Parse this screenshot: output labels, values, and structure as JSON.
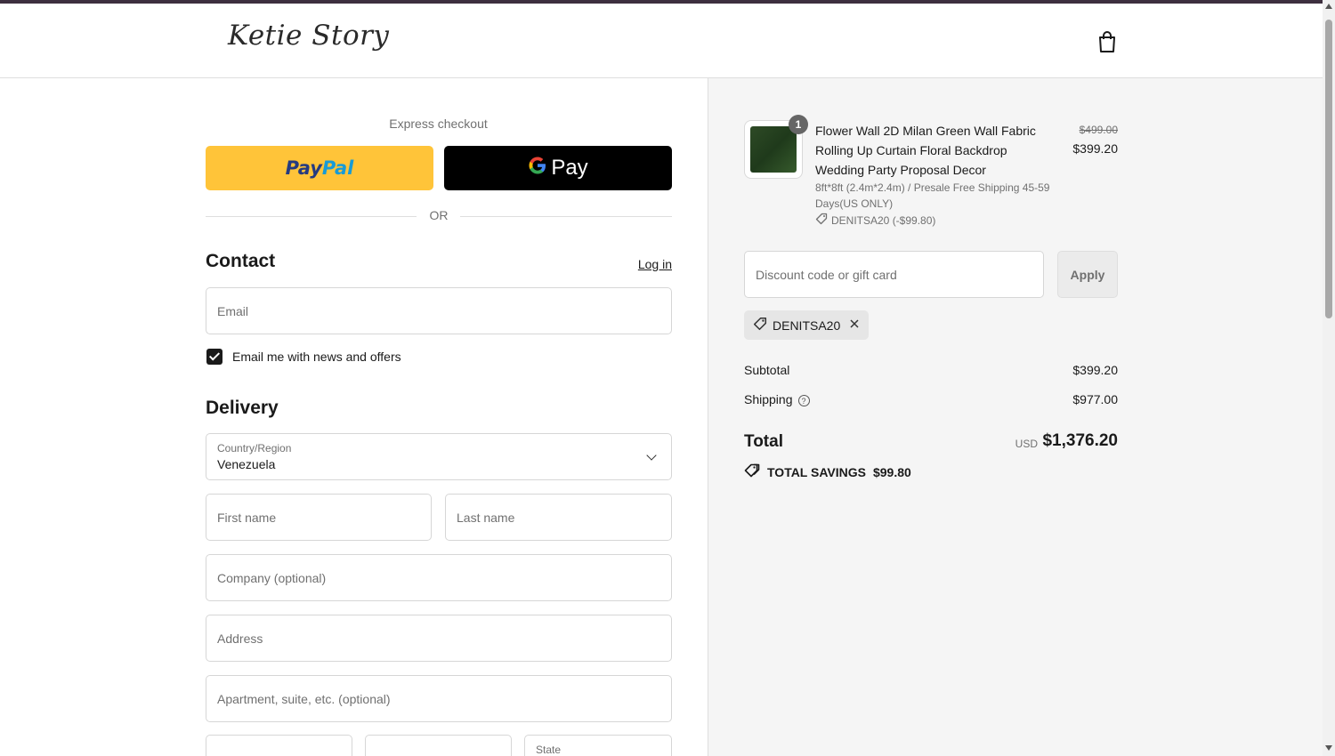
{
  "header": {
    "logo_text": "Ketie Story",
    "cart_icon": "shopping-bag-icon"
  },
  "express": {
    "label": "Express checkout",
    "paypal_part1": "Pay",
    "paypal_part2": "Pal",
    "gpay_g": "G",
    "gpay_label": "Pay",
    "or_label": "OR"
  },
  "contact": {
    "title": "Contact",
    "login_link": "Log in",
    "email_placeholder": "Email",
    "newsletter_label": "Email me with news and offers",
    "newsletter_checked": true
  },
  "delivery": {
    "title": "Delivery",
    "country_label": "Country/Region",
    "country_value": "Venezuela",
    "first_name_placeholder": "First name",
    "last_name_placeholder": "Last name",
    "company_placeholder": "Company (optional)",
    "address_placeholder": "Address",
    "apartment_placeholder": "Apartment, suite, etc. (optional)",
    "state_label": "State"
  },
  "order": {
    "quantity": "1",
    "product_title": "Flower Wall 2D Milan Green Wall Fabric Rolling Up Curtain Floral Backdrop Wedding Party Proposal Decor",
    "product_variant": "8ft*8ft  (2.4m*2.4m) / Presale Free Shipping 45-59 Days(US ONLY)",
    "product_discount": "DENITSA20 (-$99.80)",
    "price_original": "$499.00",
    "price_current": "$399.20",
    "discount_placeholder": "Discount code or gift card",
    "apply_label": "Apply",
    "applied_code": "DENITSA20",
    "subtotal_label": "Subtotal",
    "subtotal_value": "$399.20",
    "shipping_label": "Shipping",
    "shipping_value": "$977.00",
    "total_label": "Total",
    "total_currency": "USD",
    "total_value": "$1,376.20",
    "savings_label": "TOTAL SAVINGS",
    "savings_value": "$99.80"
  },
  "colors": {
    "paypal_yellow": "#ffc439",
    "gpay_black": "#000000",
    "summary_bg": "#f5f5f5",
    "top_accent": "#3d2f3f"
  }
}
